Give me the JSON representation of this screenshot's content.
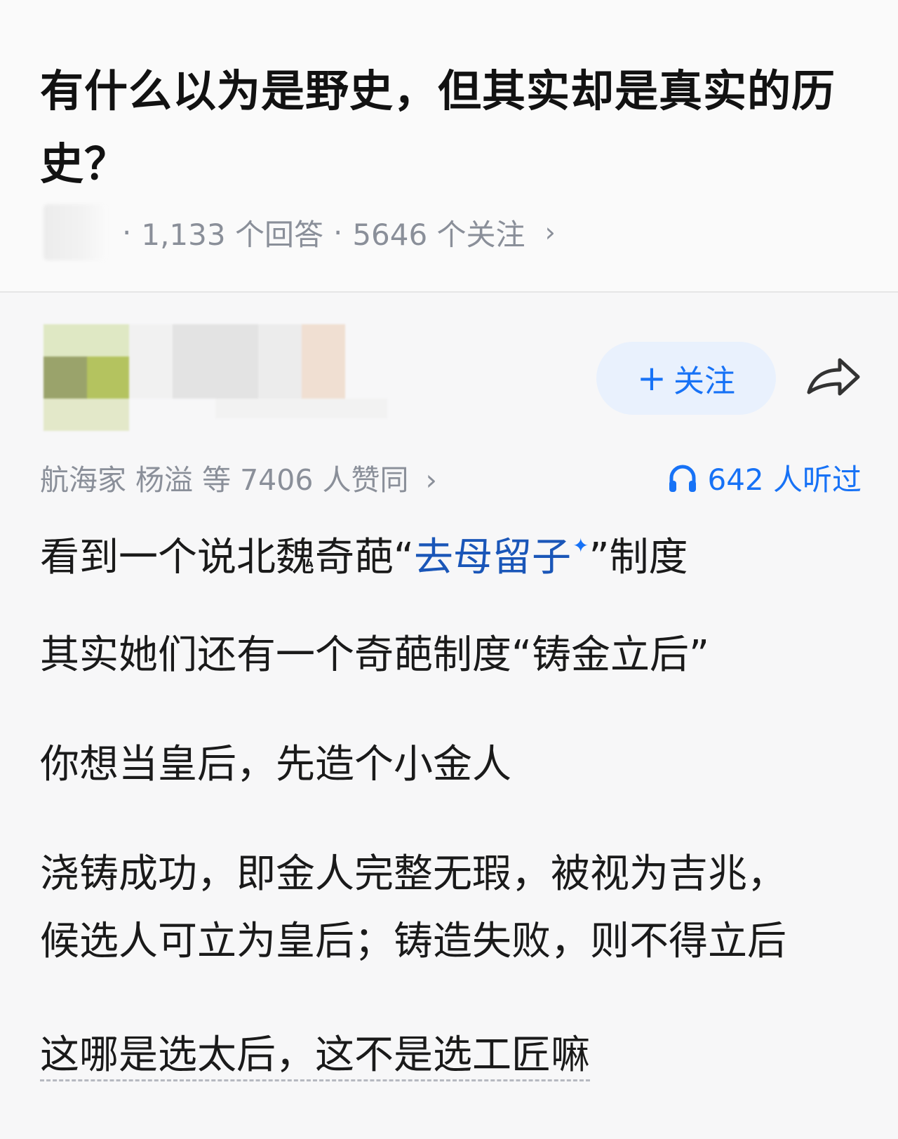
{
  "question": {
    "title": "有什么以为是野史，但其实却是真实的历史？",
    "answers_count": "1,133 个回答",
    "followers_count": "5646 个关注",
    "separator": "·",
    "arrow": "›"
  },
  "author": {
    "follow_label": "关注",
    "follow_icon": "plus-icon",
    "share_icon": "share-arrow-icon"
  },
  "stats": {
    "upvoters": "航海家 杨溢 等 7406 人赞同",
    "arrow": "›",
    "listened": "642 人听过",
    "listen_icon": "headphone-icon",
    "accent_color": "#1772f6"
  },
  "answer": {
    "p1_before": "看到一个说北魏奇葩“",
    "p1_link": "去母留子",
    "p1_spark": "✦",
    "p1_after": "”制度",
    "p2": "其实她们还有一个奇葩制度“铸金立后”",
    "p3": "你想当皇后，先造个小金人",
    "p4_line1": "浇铸成功，即金人完整无瑕，被视为吉兆，",
    "p4_line2": "候选人可立为皇后；铸造失败，则不得立后",
    "p5": "这哪是选太后，这不是选工匠嘛"
  }
}
